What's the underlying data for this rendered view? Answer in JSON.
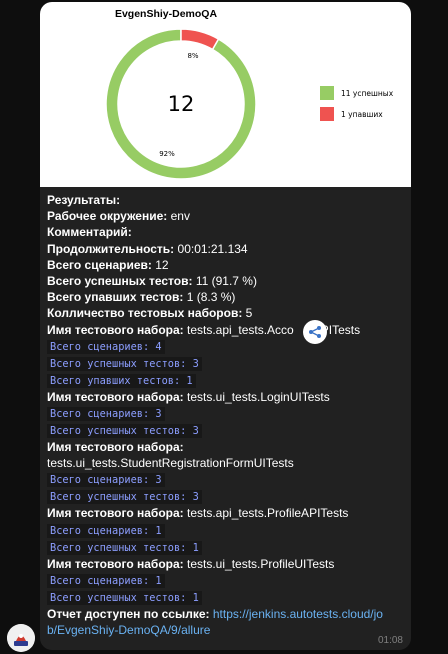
{
  "chart_data": {
    "type": "pie",
    "title": "EvgenShiy-DemoQA",
    "center_label": "12",
    "slices": [
      {
        "label": "11 успешных",
        "value": 11,
        "pct_label": "92%",
        "color": "#97cc64"
      },
      {
        "label": "1 упавших",
        "value": 1,
        "pct_label": "8%",
        "color": "#ef5350"
      }
    ]
  },
  "message": {
    "results_label": "Результаты:",
    "env_label": "Рабочее окружение:",
    "env_value": " env",
    "comment_label": "Комментарий:",
    "duration_label": "Продолжительность:",
    "duration_value": " 00:01:21.134",
    "total_label": "Всего сценариев:",
    "total_value": " 12",
    "passed_label": "Всего успешных тестов:",
    "passed_value": " 11 (91.7 %)",
    "failed_label": "Всего упавших тестов:",
    "failed_value": " 1 (8.3 %)",
    "suites_label": "Колличество тестовых наборов:",
    "suites_value": " 5",
    "suite_name_label": "Имя тестового набора:",
    "suites": [
      {
        "name": " tests.api_tests.Acco",
        "name_tail": "APITests",
        "lines": [
          "Всего сценариев: 4",
          "Всего успешных тестов: 3",
          "Всего упавших тестов: 1"
        ]
      },
      {
        "name": " tests.ui_tests.LoginUITests",
        "lines": [
          "Всего сценариев: 3",
          "Всего успешных тестов: 3"
        ]
      },
      {
        "name_line2": "tests.ui_tests.StudentRegistrationFormUITests",
        "lines": [
          "Всего сценариев: 3",
          "Всего успешных тестов: 3"
        ]
      },
      {
        "name": " tests.api_tests.ProfileAPITests",
        "lines": [
          "Всего сценариев: 1",
          "Всего успешных тестов: 1"
        ]
      },
      {
        "name": " tests.ui_tests.ProfileUITests",
        "lines": [
          "Всего сценариев: 1",
          "Всего успешных тестов: 1"
        ]
      }
    ],
    "report_label": "Отчет доступен по ссылке:",
    "report_link_1": " https://jenkins.autotests.cloud/jo",
    "report_link_2": "b/EvgenShiy-DemoQA/9/allure",
    "time": "01:08"
  },
  "colors": {
    "bubble": "#212121",
    "code": "#8c9eff",
    "link": "#6ab2f2"
  }
}
